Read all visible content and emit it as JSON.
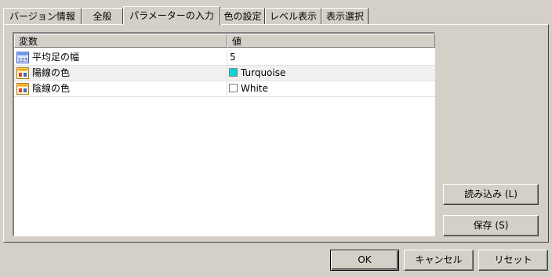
{
  "tabs": [
    {
      "label": "バージョン情報"
    },
    {
      "label": "全般"
    },
    {
      "label": "パラメーターの入力"
    },
    {
      "label": "色の設定"
    },
    {
      "label": "レベル表示"
    },
    {
      "label": "表示選択"
    }
  ],
  "grid": {
    "headers": [
      "変数",
      "値"
    ],
    "rows": [
      {
        "icon": "integer-param-icon",
        "name": "平均足の幅",
        "value": "5"
      },
      {
        "icon": "color-param-icon",
        "name": "陽線の色",
        "value": "Turquoise",
        "swatch": "#00d8d8"
      },
      {
        "icon": "color-param-icon",
        "name": "陰線の色",
        "value": "White",
        "swatch": "#ffffff"
      }
    ]
  },
  "side_buttons": {
    "load": "読み込み (L)",
    "save": "保存 (S)"
  },
  "footer_buttons": {
    "ok": "OK",
    "cancel": "キャンセル",
    "reset": "リセット"
  },
  "colors": {
    "face": "#d4d0c8",
    "turquoise": "#00d8d8",
    "white": "#ffffff"
  }
}
